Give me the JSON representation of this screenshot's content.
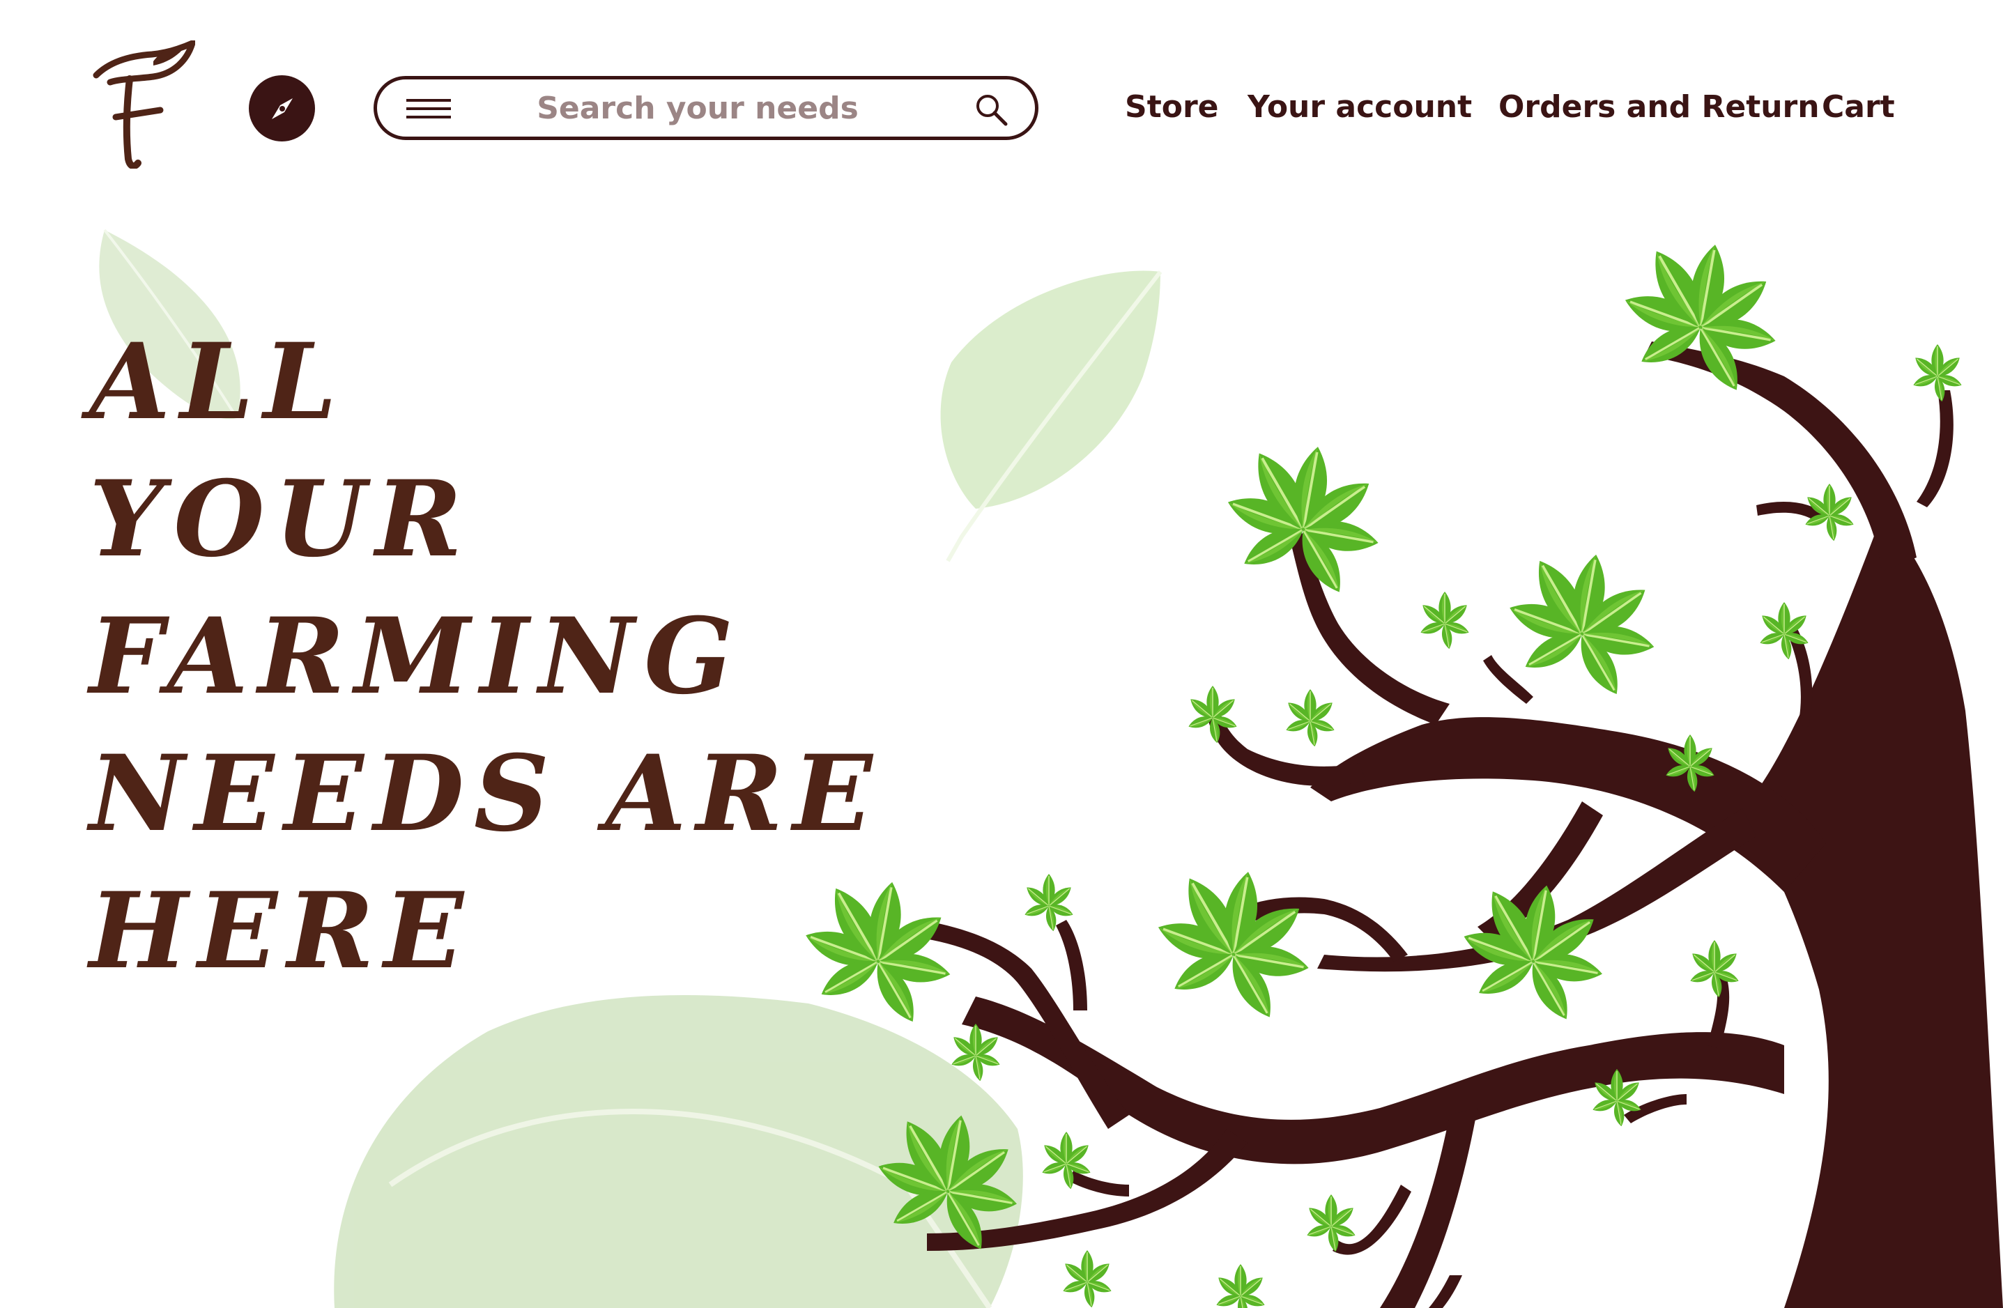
{
  "header": {
    "search": {
      "placeholder": "Search your needs",
      "value": ""
    },
    "nav": [
      {
        "label": "Store"
      },
      {
        "label": "Your account"
      },
      {
        "label": "Orders and Return"
      },
      {
        "label": "Cart"
      }
    ]
  },
  "hero": {
    "lines": [
      "ALL",
      "YOUR",
      "FARMING",
      "NEEDS ARE",
      "HERE"
    ]
  },
  "icons": {
    "logo": "brand-logo",
    "compass": "compass-icon",
    "menu": "hamburger-menu-icon",
    "search": "search-icon"
  },
  "colors": {
    "brand_dark": "#3a1414",
    "hero_text": "#4f2417",
    "placeholder_text": "#9b8585",
    "leaf_green": "#5dbb2a",
    "faded_leaf": "#cfe3b8"
  }
}
